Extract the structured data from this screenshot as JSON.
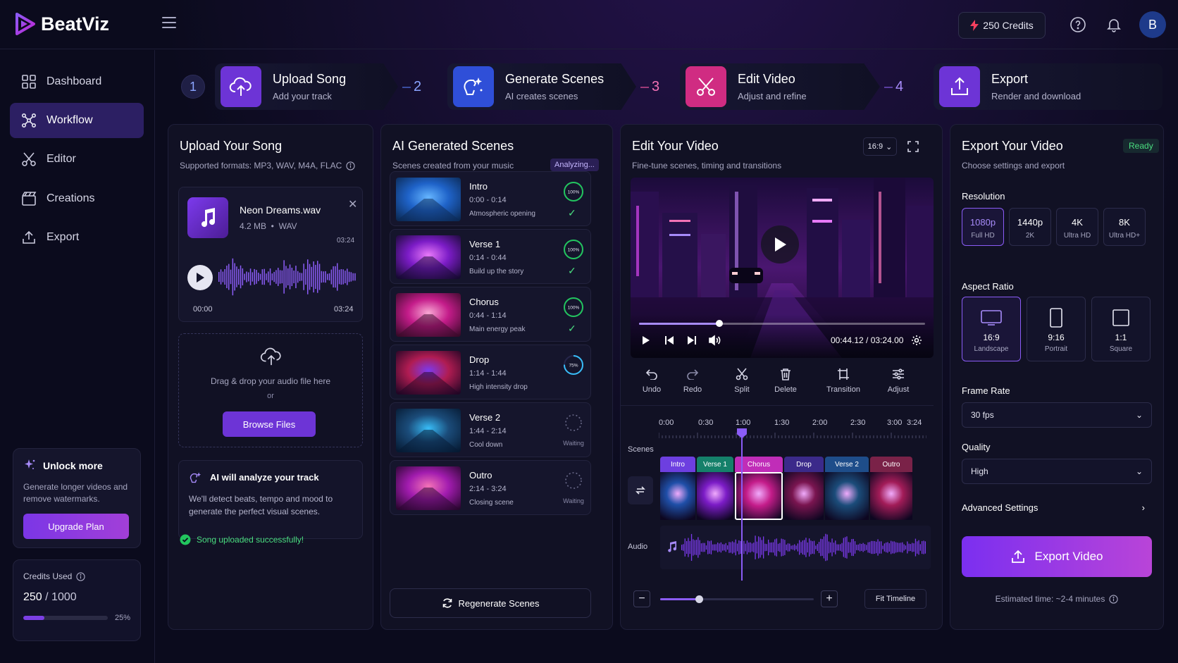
{
  "app": {
    "name": "BeatViz"
  },
  "topbar": {
    "credits_label": "250 Credits",
    "avatar_initial": "B"
  },
  "sidebar": {
    "items": [
      {
        "label": "Dashboard"
      },
      {
        "label": "Workflow",
        "active": true
      },
      {
        "label": "Editor"
      },
      {
        "label": "Creations"
      },
      {
        "label": "Export"
      }
    ],
    "unlock": {
      "title": "Unlock more",
      "desc": "Generate longer videos and remove watermarks.",
      "button": "Upgrade Plan"
    },
    "credits": {
      "label": "Credits Used",
      "used": "250",
      "total": "/ 1000",
      "percent_label": "25%",
      "fraction": 0.25
    }
  },
  "steps": [
    {
      "num": "1",
      "title": "Upload Song",
      "sub": "Add your track"
    },
    {
      "num": "2",
      "title": "Generate Scenes",
      "sub": "AI creates scenes"
    },
    {
      "num": "3",
      "title": "Edit Video",
      "sub": "Adjust and refine"
    },
    {
      "num": "4",
      "title": "Export",
      "sub": "Render and download"
    }
  ],
  "upload": {
    "title": "Upload Your Song",
    "sub": "Supported formats: MP3, WAV, M4A, FLAC",
    "file": {
      "name": "Neon Dreams.wav",
      "size": "4.2 MB",
      "format": "WAV",
      "duration": "03:24",
      "t_start": "00:00",
      "t_end": "03:24"
    },
    "dropzone": {
      "text": "Drag & drop your audio file here",
      "or": "or",
      "button": "Browse Files"
    },
    "ai": {
      "title": "AI will analyze your track",
      "desc": "We'll detect beats, tempo and mood to generate the perfect visual scenes."
    },
    "success": "Song uploaded successfully!"
  },
  "scenes": {
    "title": "AI Generated Scenes",
    "sub": "Scenes created from your music",
    "badge": "Analyzing...",
    "items": [
      {
        "name": "Intro",
        "time": "0:00 - 0:14",
        "desc": "Atmospheric opening",
        "status": "100%",
        "progress": 1.0,
        "done": true
      },
      {
        "name": "Verse 1",
        "time": "0:14 - 0:44",
        "desc": "Build up the story",
        "status": "100%",
        "progress": 1.0,
        "done": true
      },
      {
        "name": "Chorus",
        "time": "0:44 - 1:14",
        "desc": "Main energy peak",
        "status": "100%",
        "progress": 1.0,
        "done": true
      },
      {
        "name": "Drop",
        "time": "1:14 - 1:44",
        "desc": "High intensity drop",
        "status": "75%",
        "progress": 0.75,
        "done": false
      },
      {
        "name": "Verse 2",
        "time": "1:44 - 2:14",
        "desc": "Cool down",
        "status": "Waiting",
        "progress": 0,
        "done": false
      },
      {
        "name": "Outro",
        "time": "2:14 - 3:24",
        "desc": "Closing scene",
        "status": "Waiting",
        "progress": 0,
        "done": false
      }
    ],
    "regen_button": "Regenerate Scenes"
  },
  "editor": {
    "title": "Edit Your Video",
    "sub": "Fine-tune scenes, timing and transitions",
    "ratio": "16:9",
    "player": {
      "time": "00:44.12 / 03:24.00",
      "progress": 0.28
    },
    "tools": [
      {
        "label": "Undo"
      },
      {
        "label": "Redo"
      },
      {
        "label": "Split"
      },
      {
        "label": "Delete"
      },
      {
        "label": "Transition"
      },
      {
        "label": "Adjust"
      }
    ],
    "ruler": [
      "0:00",
      "0:30",
      "1:00",
      "1:30",
      "2:00",
      "2:30",
      "3:00",
      "3:24"
    ],
    "scenes_label": "Scenes",
    "audio_label": "Audio",
    "clips": [
      {
        "name": "Intro",
        "color": "#6d3fe0"
      },
      {
        "name": "Verse 1",
        "color": "#15806a"
      },
      {
        "name": "Chorus",
        "color": "#c02db8"
      },
      {
        "name": "Drop",
        "color": "#3b2a8a"
      },
      {
        "name": "Verse 2",
        "color": "#1e4d8a"
      },
      {
        "name": "Outro",
        "color": "#7a2248"
      }
    ],
    "zoom": {
      "minus": "−",
      "plus": "+",
      "level": 0.25,
      "fit_button": "Fit Timeline"
    }
  },
  "export": {
    "title": "Export Your Video",
    "sub": "Choose settings and export",
    "status": "Ready",
    "resolution_label": "Resolution",
    "resolutions": [
      {
        "main": "1080p",
        "sub": "Full HD",
        "selected": true
      },
      {
        "main": "1440p",
        "sub": "2K"
      },
      {
        "main": "4K",
        "sub": "Ultra HD"
      },
      {
        "main": "8K",
        "sub": "Ultra HD+"
      }
    ],
    "aspect_label": "Aspect Ratio",
    "aspects": [
      {
        "main": "16:9",
        "sub": "Landscape",
        "selected": true
      },
      {
        "main": "9:16",
        "sub": "Portrait"
      },
      {
        "main": "1:1",
        "sub": "Square"
      }
    ],
    "framerate_label": "Frame Rate",
    "framerate": "30 fps",
    "quality_label": "Quality",
    "quality": "High",
    "advanced": "Advanced Settings",
    "button": "Export Video",
    "estimate": "Estimated time: ~2-4 minutes"
  }
}
